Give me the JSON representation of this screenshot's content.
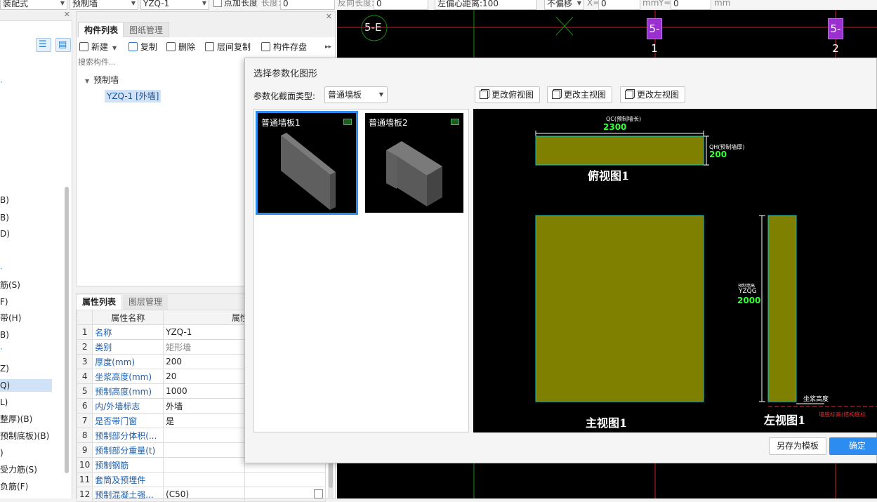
{
  "toolbar": {
    "field1_value": "装配式",
    "field2_value": "预制墙",
    "field3_value": "YZQ-1",
    "point_length_label": "点加长度",
    "length_label": "长度:",
    "length_value": "0",
    "reverse_length_label": "反向长度:",
    "reverse_length_value": "0",
    "left_offset_label": "左偏心距离:",
    "left_offset_value": "100",
    "offset_mode": "不偏移",
    "x_label": "X=",
    "x_value": "0",
    "mm1": "mm",
    "y_label": "Y=",
    "y_value": "0",
    "mm2": "mm"
  },
  "left_tree": {
    "items": [
      "B)",
      "B)",
      "D)",
      "筋(S)",
      "F)",
      "带(H)",
      "B)",
      "Z)",
      "Q)",
      "L)",
      "整厚)(B)",
      "预制底板)(B)",
      ")",
      "受力筋(S)",
      "负筋(F)"
    ],
    "selected_index": 8
  },
  "component_panel": {
    "tab_active": "构件列表",
    "tab_inactive": "图纸管理",
    "cmd_new": "新建",
    "cmd_copy": "复制",
    "cmd_delete": "删除",
    "cmd_floor_copy": "层间复制",
    "cmd_save": "构件存盘",
    "search_placeholder": "搜索构件...",
    "tree_root": "预制墙",
    "tree_child": "YZQ-1 [外墙]"
  },
  "property_panel": {
    "tab_active": "属性列表",
    "tab_inactive": "图层管理",
    "col_name": "属性名称",
    "col_value": "属性值",
    "rows": [
      {
        "num": "1",
        "name": "名称",
        "value": "YZQ-1"
      },
      {
        "num": "2",
        "name": "类别",
        "value": "矩形墙"
      },
      {
        "num": "3",
        "name": "厚度(mm)",
        "value": "200"
      },
      {
        "num": "4",
        "name": "坐浆高度(mm)",
        "value": "20"
      },
      {
        "num": "5",
        "name": "预制高度(mm)",
        "value": "1000"
      },
      {
        "num": "6",
        "name": "内/外墙标志",
        "value": "外墙"
      },
      {
        "num": "7",
        "name": "是否带门窗",
        "value": "是"
      },
      {
        "num": "8",
        "name": "预制部分体积(...",
        "value": ""
      },
      {
        "num": "9",
        "name": "预制部分重量(t)",
        "value": ""
      },
      {
        "num": "10",
        "name": "预制钢筋",
        "value": ""
      },
      {
        "num": "11",
        "name": "套筒及预埋件",
        "value": ""
      },
      {
        "num": "12",
        "name": "预制混凝土强...",
        "value": "(C50)"
      }
    ]
  },
  "cad": {
    "axis_label": "5-E",
    "tag1": "5-1",
    "tag2": "5-2"
  },
  "dialog": {
    "title": "选择参数化图形",
    "type_label": "参数化截面类型:",
    "type_value": "普通墙板",
    "btn_top_view": "更改俯视图",
    "btn_front_view": "更改主视图",
    "btn_left_view": "更改左视图",
    "shape1_label": "普通墙板1",
    "shape2_label": "普通墙板2",
    "save_template": "另存为模板",
    "ok": "确定"
  },
  "preview": {
    "qc_label": "QC(预制墙长)",
    "qc_value": "2300",
    "qh_label": "QH(预制墙厚)",
    "qh_value": "200",
    "top_view_title": "俯视图1",
    "height_label_small": "预制墙高",
    "height_code": "YZQG",
    "height_value": "2000",
    "front_view_title": "主视图1",
    "left_view_title": "左视图1",
    "grout_label": "坐浆高度",
    "elev_label": "墙底标高(结构底标"
  },
  "colors": {
    "accent": "#2d8cf0",
    "wall_fill": "#808000",
    "wall_edge": "#00c8d0",
    "dim_green": "#33ff33",
    "axis_tag": "#9b30d0"
  }
}
